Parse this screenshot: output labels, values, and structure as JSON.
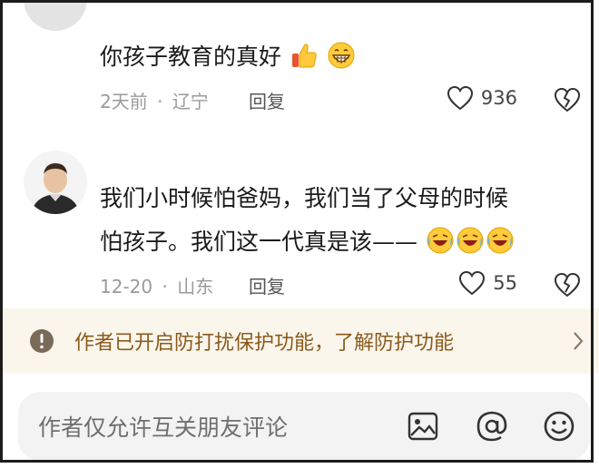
{
  "comments": [
    {
      "text": "你孩子教育的真好",
      "emoji": [
        "thumbs-up",
        "grin"
      ],
      "time": "2天前",
      "sep": "·",
      "location": "辽宁",
      "reply": "回复",
      "likes": "936"
    },
    {
      "line1": "我们小时候怕爸妈，我们当了父母的时候",
      "line2": "怕孩子。我们这一代真是该——",
      "emoji": [
        "rofl",
        "rofl",
        "rofl"
      ],
      "time": "12-20",
      "sep": "·",
      "location": "山东",
      "reply": "回复",
      "likes": "55"
    }
  ],
  "notice": {
    "text": "作者已开启防打扰保护功能，了解防护功能",
    "color": "#8a5a1c",
    "background": "#fbf6ec"
  },
  "input": {
    "placeholder": "作者仅允许互关朋友评论"
  },
  "icons": {
    "like": "heart-outline-icon",
    "dislike": "broken-heart-icon",
    "image": "image-icon",
    "mention": "at-sign-icon",
    "emoji": "smiley-icon"
  }
}
